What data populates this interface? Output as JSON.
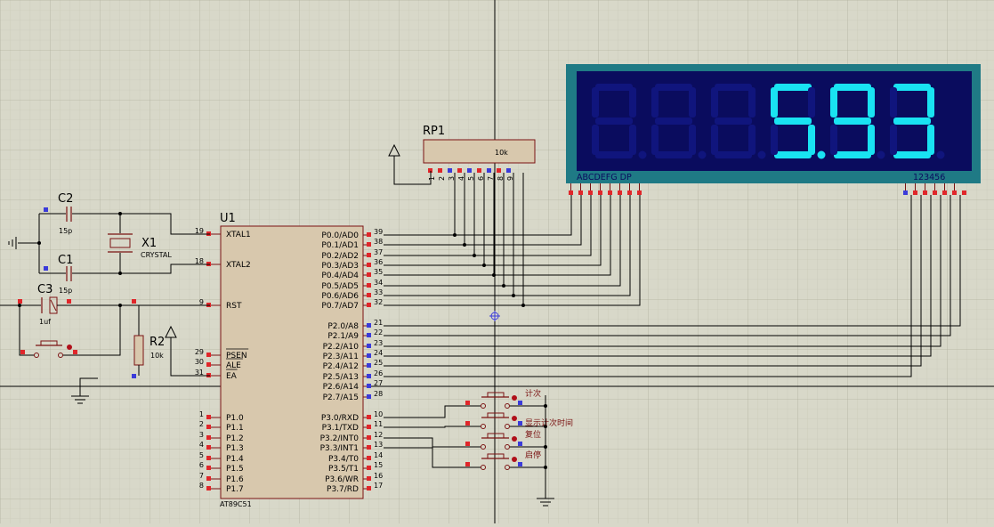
{
  "display": {
    "digits": [
      "",
      "",
      "",
      "5",
      "9",
      "3"
    ],
    "dp_digit_index": 3,
    "seg_pin_label": "ABCDEFG  DP",
    "dig_pin_label": "123456",
    "colors": {
      "frame": "#1f7a85",
      "bg": "#0a0c5e",
      "seg_on": "#19e3f2",
      "seg_off": "#10157d"
    }
  },
  "rp1": {
    "ref": "RP1",
    "value": "10k",
    "pins": [
      "1",
      "2",
      "3",
      "4",
      "5",
      "6",
      "7",
      "8",
      "9"
    ]
  },
  "u1": {
    "ref": "U1",
    "part": "AT89C51",
    "left_pins": [
      {
        "num": "19",
        "name": "XTAL1"
      },
      {
        "num": "18",
        "name": "XTAL2"
      },
      {
        "num": "9",
        "name": "RST"
      },
      {
        "num": "29",
        "name": "PSEN"
      },
      {
        "num": "30",
        "name": "ALE"
      },
      {
        "num": "31",
        "name": "EA"
      },
      {
        "num": "1",
        "name": "P1.0"
      },
      {
        "num": "2",
        "name": "P1.1"
      },
      {
        "num": "3",
        "name": "P1.2"
      },
      {
        "num": "4",
        "name": "P1.3"
      },
      {
        "num": "5",
        "name": "P1.4"
      },
      {
        "num": "6",
        "name": "P1.5"
      },
      {
        "num": "7",
        "name": "P1.6"
      },
      {
        "num": "8",
        "name": "P1.7"
      }
    ],
    "right_pins": [
      {
        "num": "39",
        "name": "P0.0/AD0"
      },
      {
        "num": "38",
        "name": "P0.1/AD1"
      },
      {
        "num": "37",
        "name": "P0.2/AD2"
      },
      {
        "num": "36",
        "name": "P0.3/AD3"
      },
      {
        "num": "35",
        "name": "P0.4/AD4"
      },
      {
        "num": "34",
        "name": "P0.5/AD5"
      },
      {
        "num": "33",
        "name": "P0.6/AD6"
      },
      {
        "num": "32",
        "name": "P0.7/AD7"
      },
      {
        "num": "21",
        "name": "P2.0/A8"
      },
      {
        "num": "22",
        "name": "P2.1/A9"
      },
      {
        "num": "23",
        "name": "P2.2/A10"
      },
      {
        "num": "24",
        "name": "P2.3/A11"
      },
      {
        "num": "25",
        "name": "P2.4/A12"
      },
      {
        "num": "26",
        "name": "P2.5/A13"
      },
      {
        "num": "27",
        "name": "P2.6/A14"
      },
      {
        "num": "28",
        "name": "P2.7/A15"
      },
      {
        "num": "10",
        "name": "P3.0/RXD"
      },
      {
        "num": "11",
        "name": "P3.1/TXD"
      },
      {
        "num": "12",
        "name": "P3.2/INT0"
      },
      {
        "num": "13",
        "name": "P3.3/INT1"
      },
      {
        "num": "14",
        "name": "P3.4/T0"
      },
      {
        "num": "15",
        "name": "P3.5/T1"
      },
      {
        "num": "16",
        "name": "P3.6/WR"
      },
      {
        "num": "17",
        "name": "P3.7/RD"
      }
    ]
  },
  "components": {
    "c2": {
      "ref": "C2",
      "value": "15p"
    },
    "c1": {
      "ref": "C1",
      "value": "15p"
    },
    "c3": {
      "ref": "C3",
      "value": "1uf"
    },
    "x1": {
      "ref": "X1",
      "value": "CRYSTAL"
    },
    "r2": {
      "ref": "R2",
      "value": "10k"
    }
  },
  "buttons": [
    {
      "label": "计次"
    },
    {
      "label": "显示计次时间"
    },
    {
      "label": "复位"
    },
    {
      "label": "启停"
    }
  ]
}
